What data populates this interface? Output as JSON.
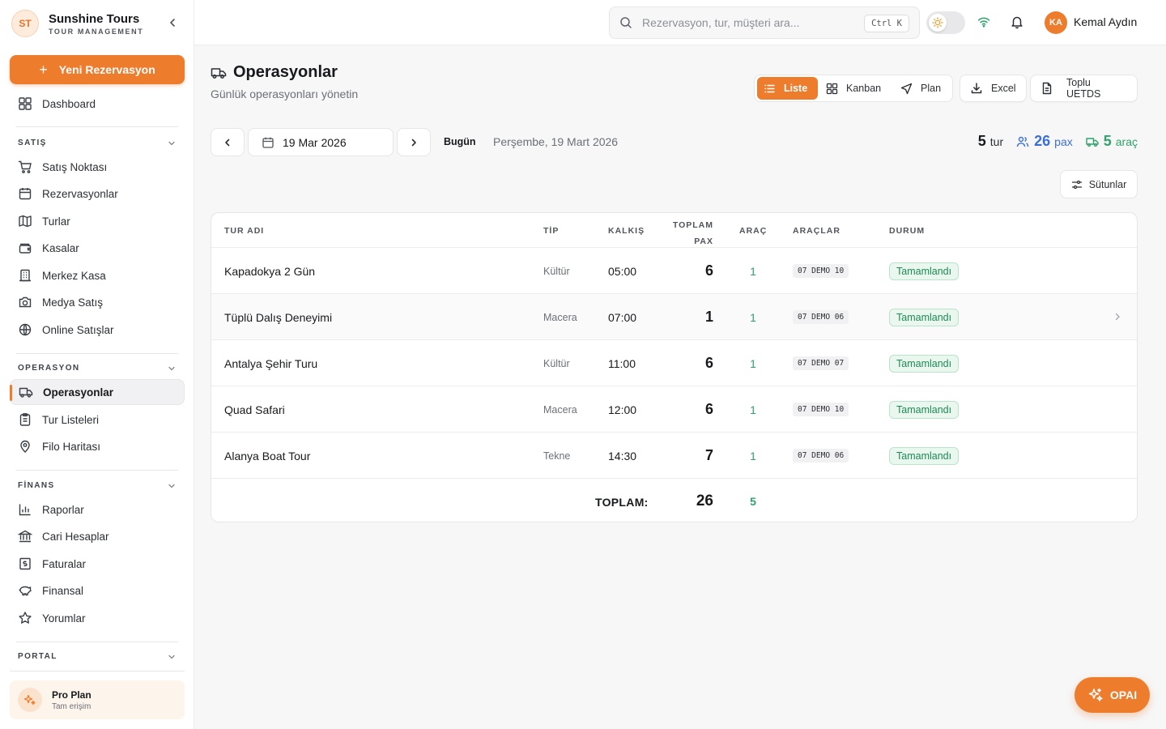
{
  "brand": {
    "initials": "ST",
    "name": "Sunshine Tours",
    "subtitle": "TOUR MANAGEMENT"
  },
  "sidebar": {
    "new_button": "Yeni Rezervasyon",
    "dashboard": "Dashboard",
    "sections": {
      "satis": {
        "label": "SATIŞ",
        "items": [
          "Satış Noktası",
          "Rezervasyonlar",
          "Turlar",
          "Kasalar",
          "Merkez Kasa",
          "Medya Satış",
          "Online Satışlar"
        ]
      },
      "operasyon": {
        "label": "OPERASYON",
        "items": [
          "Operasyonlar",
          "Tur Listeleri",
          "Filo Haritası"
        ]
      },
      "finans": {
        "label": "FİNANS",
        "items": [
          "Raporlar",
          "Cari Hesaplar",
          "Faturalar",
          "Finansal",
          "Yorumlar"
        ]
      },
      "portal": {
        "label": "PORTAL"
      }
    },
    "plan": {
      "title": "Pro Plan",
      "subtitle": "Tam erişim"
    }
  },
  "header": {
    "search_placeholder": "Rezervasyon, tur, müşteri ara...",
    "shortcut": "Ctrl K",
    "user": {
      "initials": "KA",
      "name": "Kemal Aydın"
    }
  },
  "page": {
    "title": "Operasyonlar",
    "subtitle": "Günlük operasyonları yönetin",
    "views": [
      "Liste",
      "Kanban",
      "Plan"
    ],
    "active_view": "Liste",
    "excel_label": "Excel",
    "uetds_label": "Toplu UETDS",
    "date": "19 Mar 2026",
    "today_label": "Bugün",
    "date_long": "Perşembe, 19 Mart 2026",
    "stats": {
      "tours": {
        "value": "5",
        "label": "tur"
      },
      "pax": {
        "value": "26",
        "label": "pax"
      },
      "vehicles": {
        "value": "5",
        "label": "araç"
      }
    },
    "columns_button": "Sütunlar"
  },
  "table": {
    "headers": {
      "name": "TUR ADI",
      "type": "TİP",
      "departure": "KALKIŞ",
      "pax_1": "TOPLAM",
      "pax_2": "PAX",
      "vehicle": "ARAÇ",
      "vehicles": "ARAÇLAR",
      "status": "DURUM"
    },
    "rows": [
      {
        "name": "Kapadokya 2 Gün",
        "type": "Kültür",
        "departure": "05:00",
        "pax": "6",
        "vehicle": "1",
        "plate": "07 DEMO 10",
        "status": "Tamamlandı"
      },
      {
        "name": "Tüplü Dalış Deneyimi",
        "type": "Macera",
        "departure": "07:00",
        "pax": "1",
        "vehicle": "1",
        "plate": "07 DEMO 06",
        "status": "Tamamlandı"
      },
      {
        "name": "Antalya Şehir Turu",
        "type": "Kültür",
        "departure": "11:00",
        "pax": "6",
        "vehicle": "1",
        "plate": "07 DEMO 07",
        "status": "Tamamlandı"
      },
      {
        "name": "Quad Safari",
        "type": "Macera",
        "departure": "12:00",
        "pax": "6",
        "vehicle": "1",
        "plate": "07 DEMO 10",
        "status": "Tamamlandı"
      },
      {
        "name": "Alanya Boat Tour",
        "type": "Tekne",
        "departure": "14:30",
        "pax": "7",
        "vehicle": "1",
        "plate": "07 DEMO 06",
        "status": "Tamamlandı"
      }
    ],
    "footer": {
      "label": "TOPLAM:",
      "pax": "26",
      "vehicles": "5"
    }
  },
  "assistant_button": "OPAI",
  "colors": {
    "accent": "#ee7c2d",
    "success": "#2fa36b",
    "pax_blue": "#3b6fd8"
  }
}
